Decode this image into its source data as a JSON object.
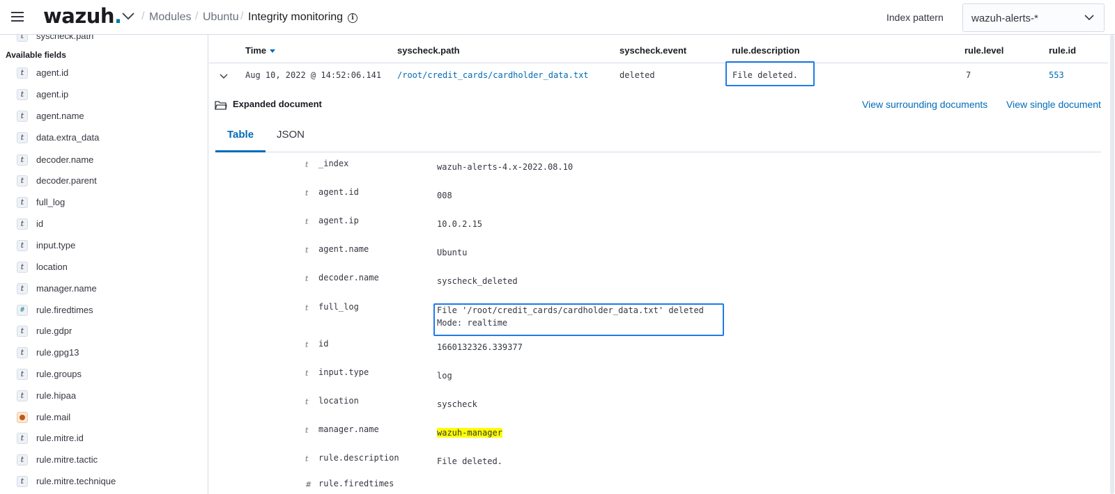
{
  "header": {
    "logo": "wazuh",
    "logo_dot": ".",
    "breadcrumb": [
      "Modules",
      "Ubuntu",
      "Integrity monitoring"
    ],
    "separator": "/",
    "info_glyph": "i",
    "index_pattern_label": "Index pattern",
    "index_pattern_value": "wazuh-alerts-*"
  },
  "sidebar": {
    "top_partial": "syscheck.path",
    "section_title": "Available fields",
    "fields": [
      {
        "name": "agent.id",
        "type": "t"
      },
      {
        "name": "agent.ip",
        "type": "t"
      },
      {
        "name": "agent.name",
        "type": "t"
      },
      {
        "name": "data.extra_data",
        "type": "t"
      },
      {
        "name": "decoder.name",
        "type": "t"
      },
      {
        "name": "decoder.parent",
        "type": "t"
      },
      {
        "name": "full_log",
        "type": "t"
      },
      {
        "name": "id",
        "type": "t"
      },
      {
        "name": "input.type",
        "type": "t"
      },
      {
        "name": "location",
        "type": "t"
      },
      {
        "name": "manager.name",
        "type": "t"
      },
      {
        "name": "rule.firedtimes",
        "type": "#"
      },
      {
        "name": "rule.gdpr",
        "type": "t"
      },
      {
        "name": "rule.gpg13",
        "type": "t"
      },
      {
        "name": "rule.groups",
        "type": "t"
      },
      {
        "name": "rule.hipaa",
        "type": "t"
      },
      {
        "name": "rule.mail",
        "type": "bool"
      },
      {
        "name": "rule.mitre.id",
        "type": "t"
      },
      {
        "name": "rule.mitre.tactic",
        "type": "t"
      },
      {
        "name": "rule.mitre.technique",
        "type": "t"
      }
    ]
  },
  "table": {
    "columns": [
      "Time",
      "syscheck.path",
      "syscheck.event",
      "rule.description",
      "rule.level",
      "rule.id"
    ],
    "row": {
      "time": "Aug 10, 2022 @ 14:52:06.141",
      "path": "/root/credit_cards/cardholder_data.txt",
      "event": "deleted",
      "description": "File deleted.",
      "level": "7",
      "rule_id": "553"
    }
  },
  "expanded": {
    "title": "Expanded document",
    "view_surrounding": "View surrounding documents",
    "view_single": "View single document",
    "tabs": [
      "Table",
      "JSON"
    ],
    "fields": [
      {
        "type": "t",
        "name": "_index",
        "value": "wazuh-alerts-4.x-2022.08.10"
      },
      {
        "type": "t",
        "name": "agent.id",
        "value": "008"
      },
      {
        "type": "t",
        "name": "agent.ip",
        "value": "10.0.2.15"
      },
      {
        "type": "t",
        "name": "agent.name",
        "value": "Ubuntu"
      },
      {
        "type": "t",
        "name": "decoder.name",
        "value": "syscheck_deleted"
      },
      {
        "type": "t",
        "name": "full_log",
        "value": "File '/root/credit_cards/cardholder_data.txt' deleted\nMode: realtime"
      },
      {
        "type": "t",
        "name": "id",
        "value": "1660132326.339377"
      },
      {
        "type": "t",
        "name": "input.type",
        "value": "log"
      },
      {
        "type": "t",
        "name": "location",
        "value": "syscheck"
      },
      {
        "type": "t",
        "name": "manager.name",
        "value": "wazuh-manager"
      },
      {
        "type": "t",
        "name": "rule.description",
        "value": "File deleted."
      },
      {
        "type": "#",
        "name": "rule.firedtimes",
        "value": ""
      }
    ]
  },
  "colors": {
    "accent": "#006bb8",
    "highlight_box": "#1e7be8",
    "search_mark": "#ffff00"
  }
}
